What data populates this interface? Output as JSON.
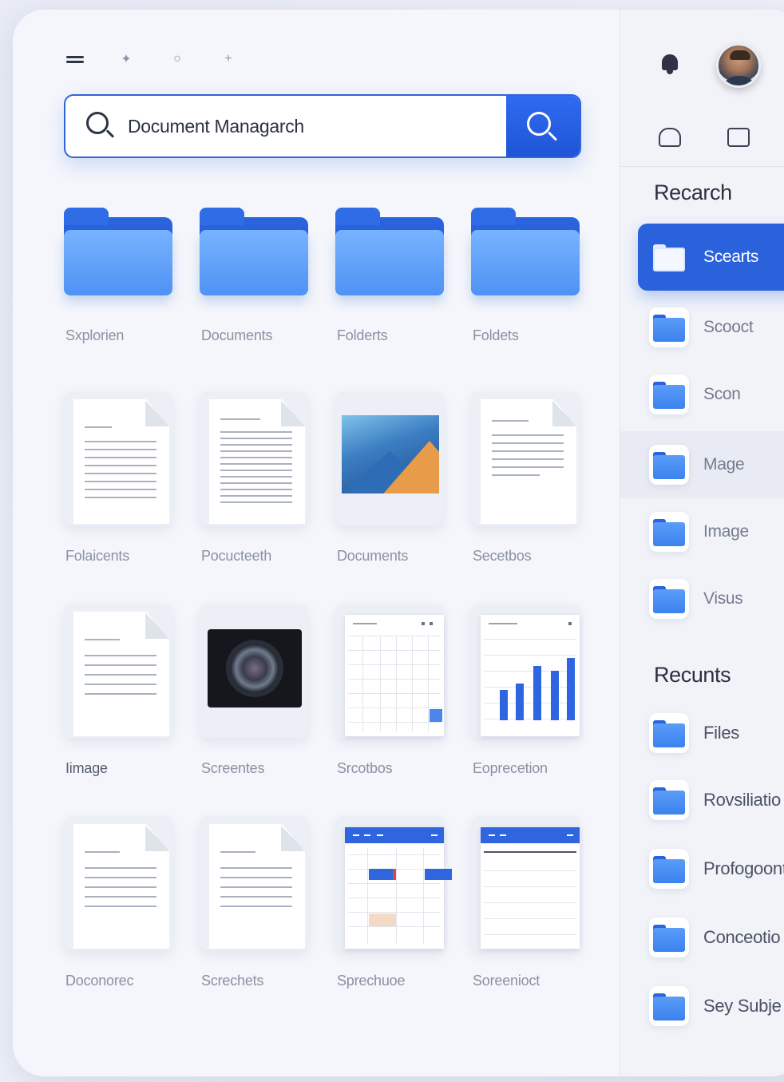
{
  "search": {
    "value": "Document Managarch"
  },
  "grid": {
    "row1": [
      "Sxplorien",
      "Documents",
      "Folderts",
      "Foldets"
    ],
    "row2": [
      "Folaicents",
      "Pocucteeth",
      "Documents",
      "Secetbos"
    ],
    "row3": [
      "Iimage",
      "Screentes",
      "Srcotbos",
      "Eoprecetion"
    ],
    "row4": [
      "Doconorec",
      "Screchets",
      "Sprechuoe",
      "Soreenioct"
    ]
  },
  "sidebar": {
    "section1_title": "Recarch",
    "section1_items": [
      "Scearts",
      "Scooct",
      "Scon",
      "Mage",
      "Image",
      "Visus"
    ],
    "section2_title": "Recunts",
    "section2_items": [
      "Files",
      "Rovsiliatio",
      "Profogoont",
      "Conceotio",
      "Sey Subje"
    ]
  },
  "icons": {
    "menu": "hamburger-icon",
    "toolbar": [
      "sparkle-icon",
      "circle-icon",
      "plus-icon"
    ],
    "search": "search-icon",
    "notifications": "bell-icon",
    "home": "home-icon",
    "calendar": "calendar-icon"
  },
  "colors": {
    "accent": "#2a62dc",
    "folder_light": "#78b3ff",
    "text_muted": "#8a91a3"
  }
}
